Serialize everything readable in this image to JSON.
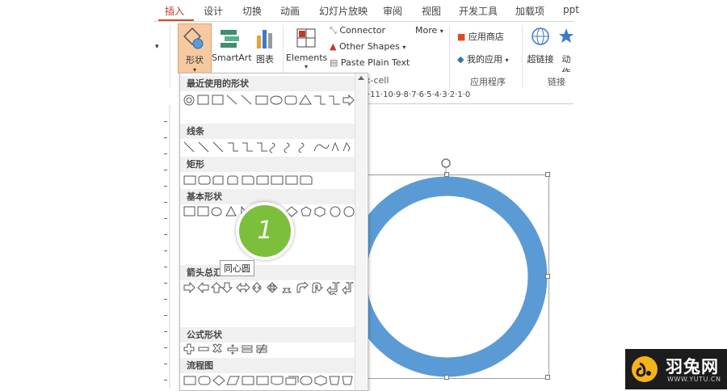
{
  "tabs": [
    "插入",
    "设计",
    "切换",
    "动画",
    "幻灯片放映",
    "审阅",
    "视图",
    "开发工具",
    "加载项",
    "ppt"
  ],
  "active_tab": "插入",
  "ribbon": {
    "shapes_label": "形状",
    "smartart_label": "SmartArt",
    "chart_label": "图表",
    "elements_label": "Elements",
    "connector_label": "Connector",
    "other_shapes_label": "Other Shapes",
    "paste_plain_label": "Paste Plain Text",
    "more_label": "More",
    "xcell_label": "x-cell",
    "store_label": "应用商店",
    "my_apps_label": "我的应用",
    "apps_group_label": "应用程序",
    "hyperlink_label": "超链接",
    "action_label": "动作",
    "links_group_label": "链接"
  },
  "ruler_text": "·11·10·9·8·7·6·5·4·3·2·1·0",
  "panel": {
    "sections": [
      "最近使用的形状",
      "线条",
      "矩形",
      "基本形状",
      "箭头总汇",
      "公式形状",
      "流程图"
    ]
  },
  "badge_number": "1",
  "tooltip_text": "同心圆",
  "shape": {
    "type": "donut",
    "color": "#5b9bd5"
  },
  "logo": {
    "text": "羽兔网",
    "url": "WWW.YUTU.CN",
    "accent": "#f6b21a"
  }
}
